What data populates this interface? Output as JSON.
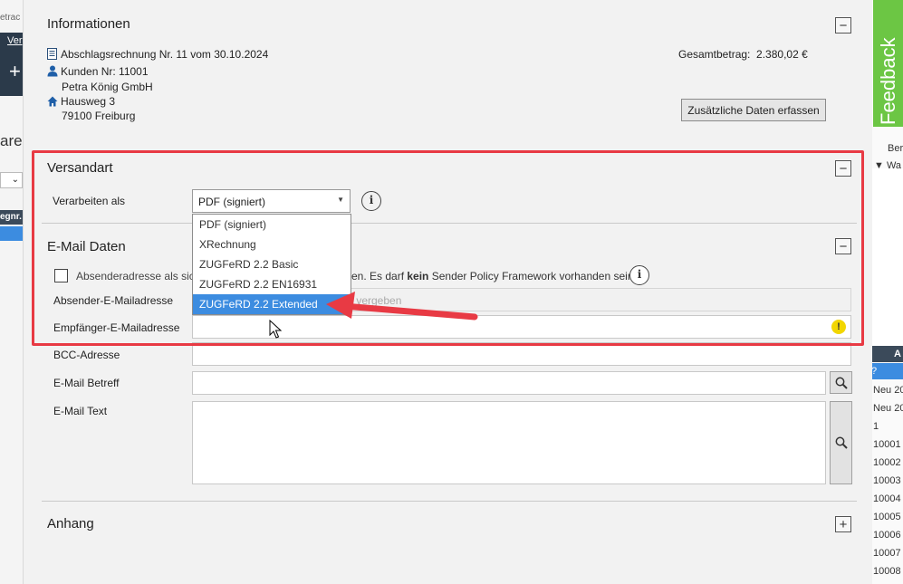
{
  "background_left": {
    "texts": [
      "etrac",
      "Ver",
      "+",
      "are",
      "egnr."
    ]
  },
  "background_right": {
    "feedback_label": "Feedback",
    "texts": [
      "Ber",
      "Wa",
      "A",
      "?",
      "Neu 20",
      "Neu 20",
      "1",
      "10001",
      "10002",
      "10003",
      "10004",
      "10005",
      "10006",
      "10007",
      "10008"
    ]
  },
  "info": {
    "title": "Informationen",
    "invoice_line": "Abschlagsrechnung Nr. 11 vom 30.10.2024",
    "customer_line": "Kunden Nr: 11001",
    "customer_name": "Petra König GmbH",
    "street": "Hausweg 3",
    "city": "79100 Freiburg",
    "total_label": "Gesamtbetrag:",
    "total_value": "2.380,02 €",
    "extra_data_button": "Zusätzliche Daten erfassen",
    "collapse_symbol": "−"
  },
  "shipping": {
    "title": "Versandart",
    "process_label": "Verarbeiten als",
    "selected_value": "PDF (signiert)",
    "options": [
      "PDF (signiert)",
      "XRechnung",
      "ZUGFeRD 2.2 Basic",
      "ZUGFeRD 2.2 EN16931",
      "ZUGFeRD 2.2 Extended"
    ],
    "highlighted_option_index": 4,
    "collapse_symbol": "−"
  },
  "email": {
    "title": "E-Mail Daten",
    "sender_checkbox_text_start": "Absenderadresse als sich",
    "sender_checkbox_text_middle": "en. Es darf ",
    "sender_checkbox_text_bold": "kein",
    "sender_checkbox_text_end": " Sender Policy Framework vorhanden sein.",
    "sender_label": "Absender-E-Mailadresse",
    "sender_placeholder": "r vergeben",
    "recipient_label": "Empfänger-E-Mailadresse",
    "bcc_label": "BCC-Adresse",
    "subject_label": "E-Mail Betreff",
    "body_label": "E-Mail Text",
    "collapse_symbol": "−"
  },
  "attachment": {
    "title": "Anhang",
    "expand_symbol": "+"
  },
  "colors": {
    "highlight_red": "#e83a44",
    "selection_blue": "#3c8ce0",
    "feedback_green": "#6cc644",
    "icon_blue": "#1f5fa8",
    "warning_yellow": "#f2d600"
  }
}
